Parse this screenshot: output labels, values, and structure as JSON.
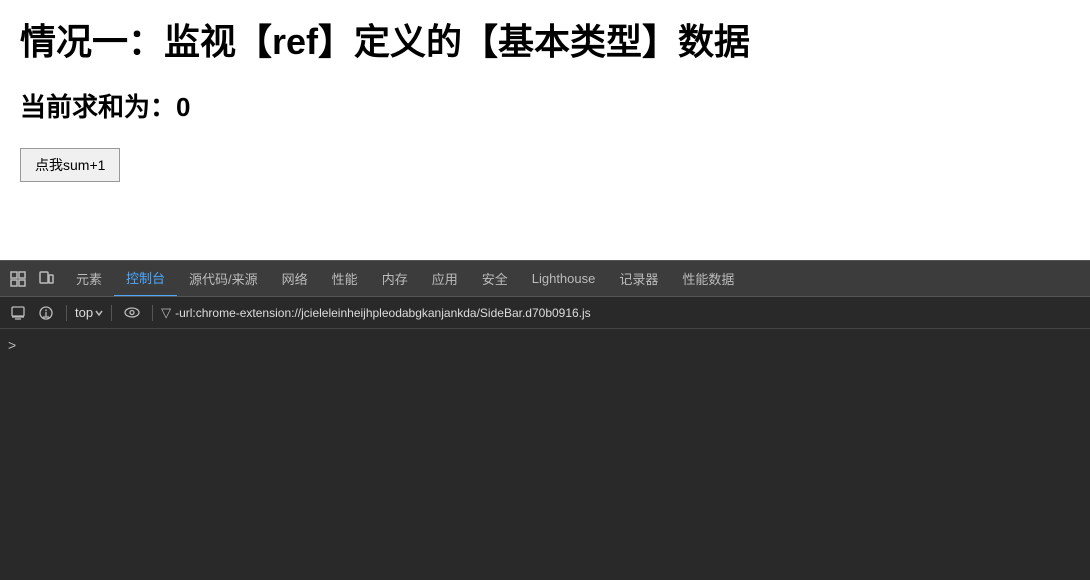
{
  "main": {
    "title": "情况一：监视【ref】定义的【基本类型】数据",
    "sum_label": "当前求和为：",
    "sum_value": "0",
    "button_label": "点我sum+1"
  },
  "devtools": {
    "tabs": [
      {
        "id": "elements",
        "label": "元素"
      },
      {
        "id": "console",
        "label": "控制台",
        "active": true
      },
      {
        "id": "sources",
        "label": "源代码/来源"
      },
      {
        "id": "network",
        "label": "网络"
      },
      {
        "id": "performance",
        "label": "性能"
      },
      {
        "id": "memory",
        "label": "内存"
      },
      {
        "id": "application",
        "label": "应用"
      },
      {
        "id": "security",
        "label": "安全"
      },
      {
        "id": "lighthouse",
        "label": "Lighthouse"
      },
      {
        "id": "recorder",
        "label": "记录器"
      },
      {
        "id": "perf-data",
        "label": "性能数据"
      }
    ],
    "toolbar": {
      "context": "top",
      "filter_text": "-url:chrome-extension://jcieleleinheijhpleodabgkanjankda/SideBar.d70b0916.js"
    }
  }
}
